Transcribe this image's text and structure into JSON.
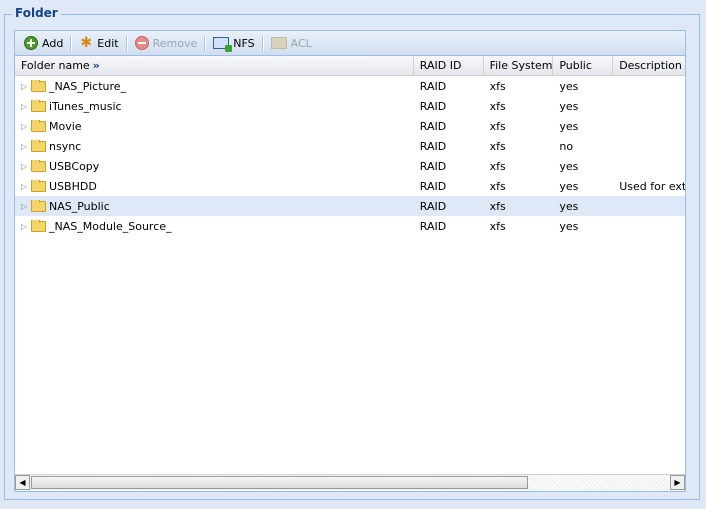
{
  "legend": "Folder",
  "toolbar": {
    "add": "Add",
    "edit": "Edit",
    "remove": "Remove",
    "nfs": "NFS",
    "acl": "ACL"
  },
  "columns": [
    "Folder name",
    "RAID ID",
    "File System",
    "Public",
    "Description"
  ],
  "sort_indicator": "»",
  "rows": [
    {
      "name": "_NAS_Picture_",
      "raid": "RAID",
      "fs": "xfs",
      "public": "yes",
      "desc": ""
    },
    {
      "name": "iTunes_music",
      "raid": "RAID",
      "fs": "xfs",
      "public": "yes",
      "desc": ""
    },
    {
      "name": "Movie",
      "raid": "RAID",
      "fs": "xfs",
      "public": "yes",
      "desc": ""
    },
    {
      "name": "nsync",
      "raid": "RAID",
      "fs": "xfs",
      "public": "no",
      "desc": ""
    },
    {
      "name": "USBCopy",
      "raid": "RAID",
      "fs": "xfs",
      "public": "yes",
      "desc": ""
    },
    {
      "name": "USBHDD",
      "raid": "RAID",
      "fs": "xfs",
      "public": "yes",
      "desc": "Used for exte"
    },
    {
      "name": "NAS_Public",
      "raid": "RAID",
      "fs": "xfs",
      "public": "yes",
      "desc": ""
    },
    {
      "name": "_NAS_Module_Source_",
      "raid": "RAID",
      "fs": "xfs",
      "public": "yes",
      "desc": ""
    }
  ],
  "selected_row": 6
}
